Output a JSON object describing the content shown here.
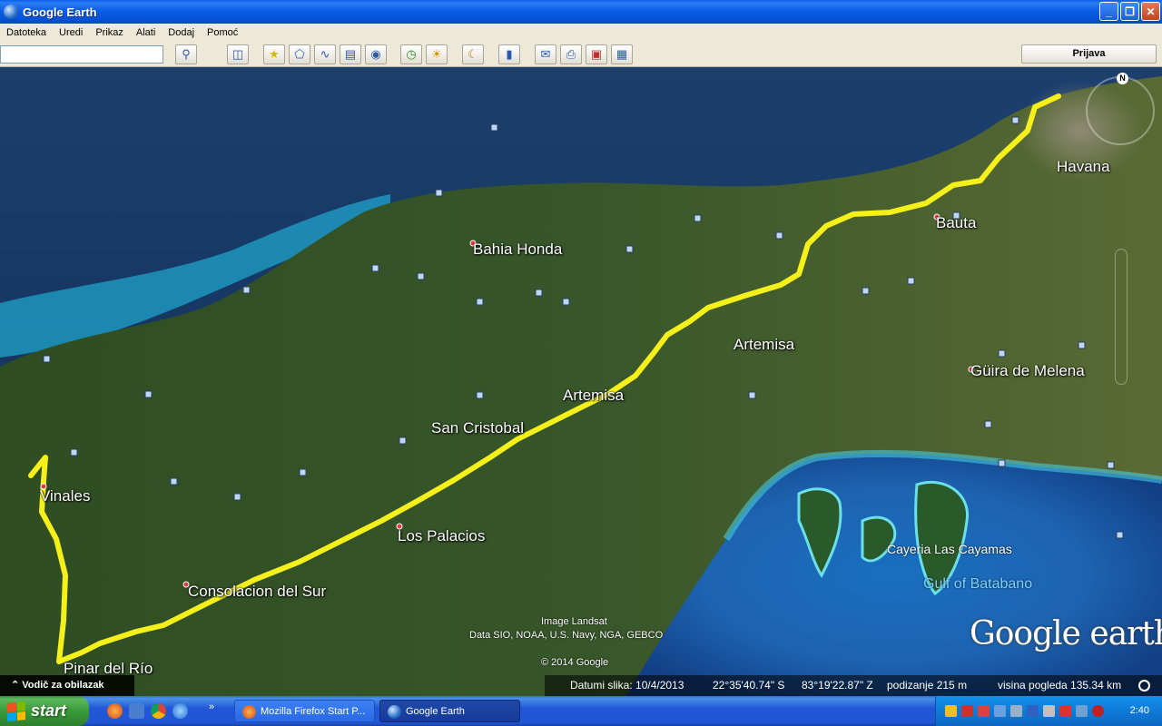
{
  "window": {
    "title": "Google Earth",
    "minimize": "_",
    "maximize": "❐",
    "close": "✕"
  },
  "menu": [
    "Datoteka",
    "Uredi",
    "Prikaz",
    "Alati",
    "Dodaj",
    "Pomoć"
  ],
  "toolbar": {
    "search_value": "",
    "signin_label": "Prijava"
  },
  "map": {
    "places": {
      "havana": "Havana",
      "bauta": "Bauta",
      "bahia_honda": "Bahia Honda",
      "artemisa_1": "Artemisa",
      "artemisa_2": "Artemisa",
      "guira": "Güira de Melena",
      "san_cristobal": "San Cristobal",
      "vinales": "Vinales",
      "los_palacios": "Los Palacios",
      "consolacion": "Consolacion del Sur",
      "pinar": "Pinar del Río",
      "cayeria": "Cayeria Las Cayamas"
    },
    "water": {
      "gulf": "Gulf of Batabano"
    },
    "credits": {
      "image": "Image Landsat",
      "data": "Data SIO, NOAA, U.S. Navy, NGA, GEBCO",
      "copyright": "© 2014 Google"
    },
    "logo": "Google earth",
    "compass_north": "N",
    "route_color": "#f5f01a"
  },
  "guide": {
    "label": "Vodič za obilazak"
  },
  "status": {
    "date": "Datumi slika: 10/4/2013",
    "lat": "22°35'40.74\" S",
    "lon": "83°19'22.87\" Z",
    "elevation": "podizanje   215 m",
    "eye_alt": "visina pogleda 135.34 km"
  },
  "taskbar": {
    "start": "start",
    "tasks": [
      "Mozilla Firefox Start P...",
      "Google Earth"
    ],
    "clock": "2:40"
  }
}
